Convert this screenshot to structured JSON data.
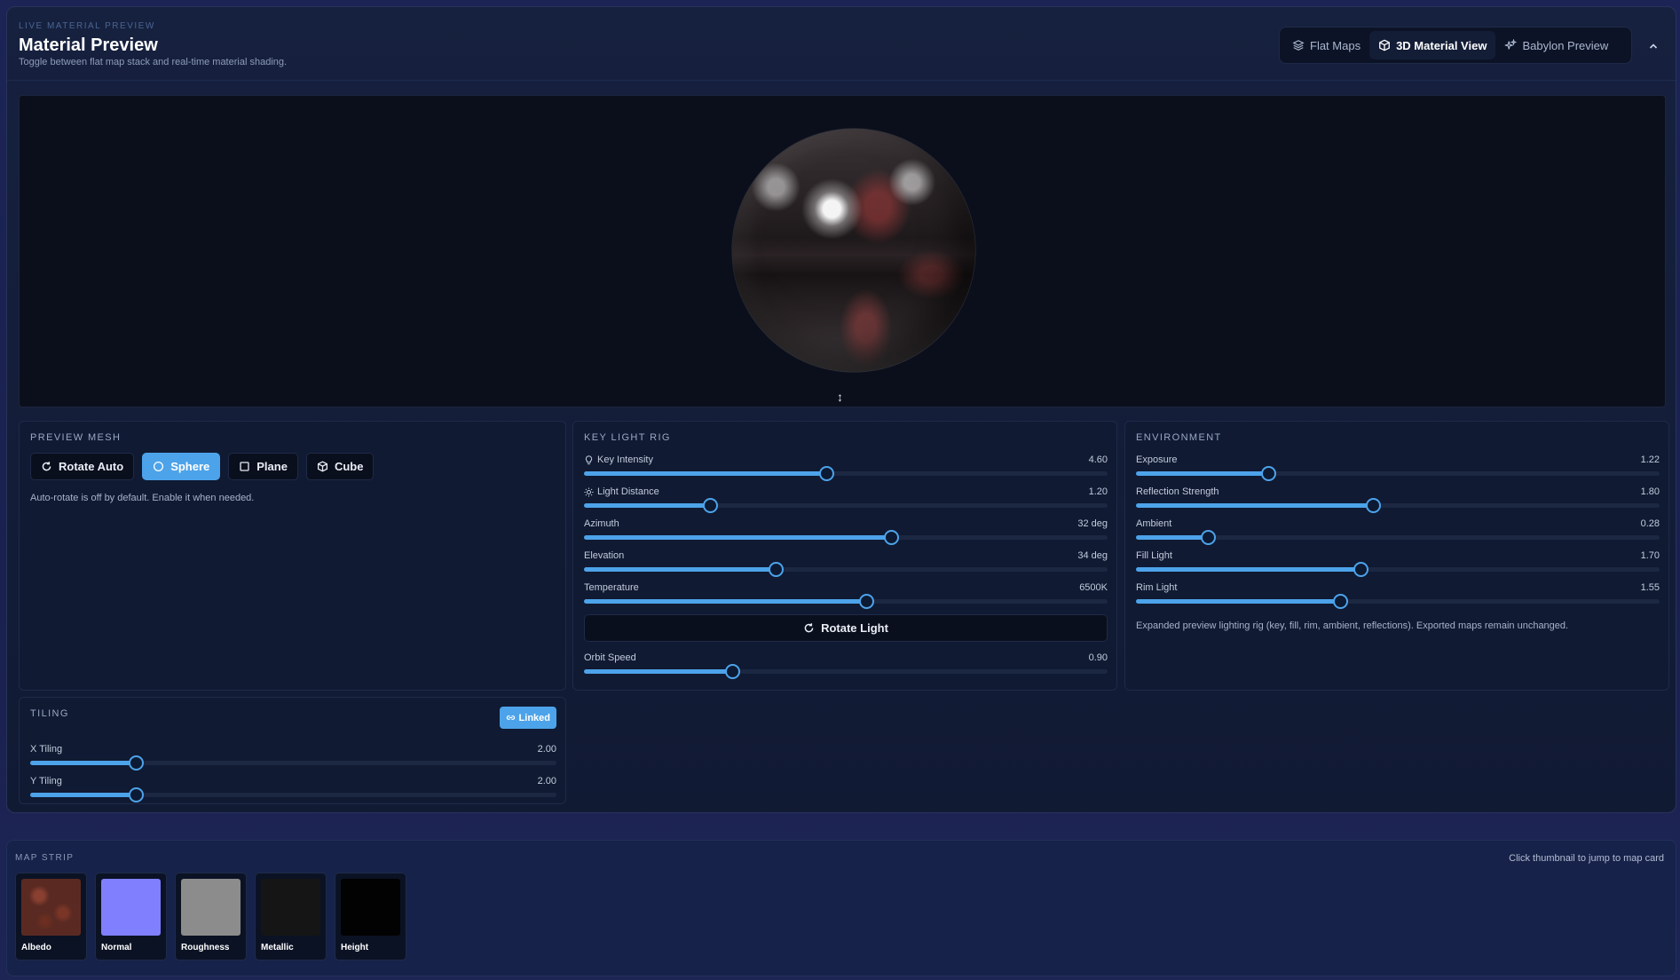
{
  "header": {
    "eyebrow": "LIVE MATERIAL PREVIEW",
    "title": "Material Preview",
    "subtitle": "Toggle between flat map stack and real-time material shading."
  },
  "view_toggle": {
    "flat_maps": "Flat Maps",
    "material_view": "3D Material View",
    "babylon_preview": "Babylon Preview",
    "active": "3D Material View"
  },
  "preview_mesh": {
    "title": "PREVIEW MESH",
    "rotate_auto": "Rotate Auto",
    "sphere": "Sphere",
    "plane": "Plane",
    "cube": "Cube",
    "active": "Sphere",
    "note": "Auto-rotate is off by default. Enable it when needed."
  },
  "key_light": {
    "title": "KEY LIGHT RIG",
    "sliders": [
      {
        "label": "Key Intensity",
        "value": "4.60",
        "fraction": 0.462
      },
      {
        "label": "Light Distance",
        "value": "1.20",
        "fraction": 0.24
      },
      {
        "label": "Azimuth",
        "value": "32 deg",
        "fraction": 0.586
      },
      {
        "label": "Elevation",
        "value": "34 deg",
        "fraction": 0.366
      },
      {
        "label": "Temperature",
        "value": "6500K",
        "fraction": 0.539
      }
    ],
    "rotate_light": "Rotate Light",
    "orbit": {
      "label": "Orbit Speed",
      "value": "0.90",
      "fraction": 0.283
    }
  },
  "environment": {
    "title": "ENVIRONMENT",
    "sliders": [
      {
        "label": "Exposure",
        "value": "1.22",
        "fraction": 0.253
      },
      {
        "label": "Reflection Strength",
        "value": "1.80",
        "fraction": 0.452
      },
      {
        "label": "Ambient",
        "value": "0.28",
        "fraction": 0.138
      },
      {
        "label": "Fill Light",
        "value": "1.70",
        "fraction": 0.428
      },
      {
        "label": "Rim Light",
        "value": "1.55",
        "fraction": 0.39
      }
    ],
    "note": "Expanded preview lighting rig (key, fill, rim, ambient, reflections). Exported maps remain unchanged."
  },
  "tiling": {
    "title": "TILING",
    "linked": "Linked",
    "sliders": [
      {
        "label": "X Tiling",
        "value": "2.00",
        "fraction": 0.2
      },
      {
        "label": "Y Tiling",
        "value": "2.00",
        "fraction": 0.2
      }
    ]
  },
  "map_strip": {
    "title": "MAP STRIP",
    "hint": "Click thumbnail to jump to map card",
    "maps": [
      {
        "label": "Albedo",
        "color": "#5a2a22"
      },
      {
        "label": "Normal",
        "color": "#8080ff"
      },
      {
        "label": "Roughness",
        "color": "#8c8c8c"
      },
      {
        "label": "Metallic",
        "color": "#151515"
      },
      {
        "label": "Height",
        "color": "#020202"
      }
    ]
  },
  "colors": {
    "accent": "#4da3ea",
    "panel": "#101a32",
    "background": "#1c2456"
  }
}
